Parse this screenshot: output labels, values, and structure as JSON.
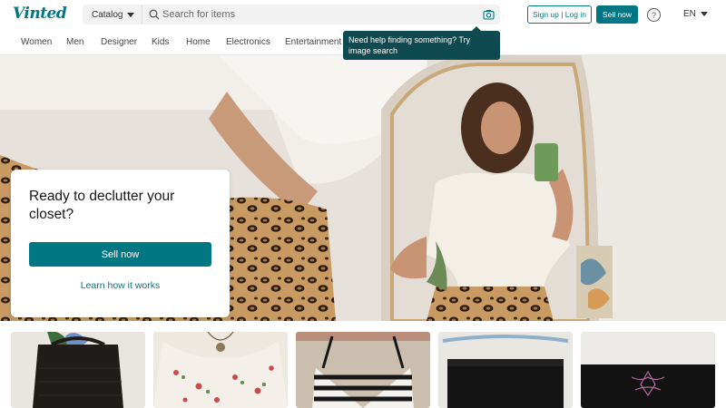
{
  "header": {
    "logo": "Vinted",
    "catalog_label": "Catalog",
    "search_placeholder": "Search for items",
    "signup_label": "Sign up | Log in",
    "sell_label": "Sell now",
    "help_glyph": "?",
    "language": "EN",
    "icons": [
      "search-icon",
      "camera-icon",
      "help-icon",
      "chevron-down-icon"
    ]
  },
  "nav": {
    "items": [
      "Women",
      "Men",
      "Designer",
      "Kids",
      "Home",
      "Electronics",
      "Entertainment"
    ]
  },
  "tooltip": {
    "text": "Need help finding something? Try image search"
  },
  "hero": {
    "title": "Ready to declutter your closet?",
    "sell_label": "Sell now",
    "learn_label": "Learn how it works"
  },
  "products": [
    {
      "name": "black-handbag"
    },
    {
      "name": "floral-top"
    },
    {
      "name": "striped-top"
    },
    {
      "name": "black-shorts"
    },
    {
      "name": "black-embroidered-top"
    }
  ],
  "colors": {
    "brand": "#007782",
    "tooltip_bg": "#0e4a4f"
  }
}
